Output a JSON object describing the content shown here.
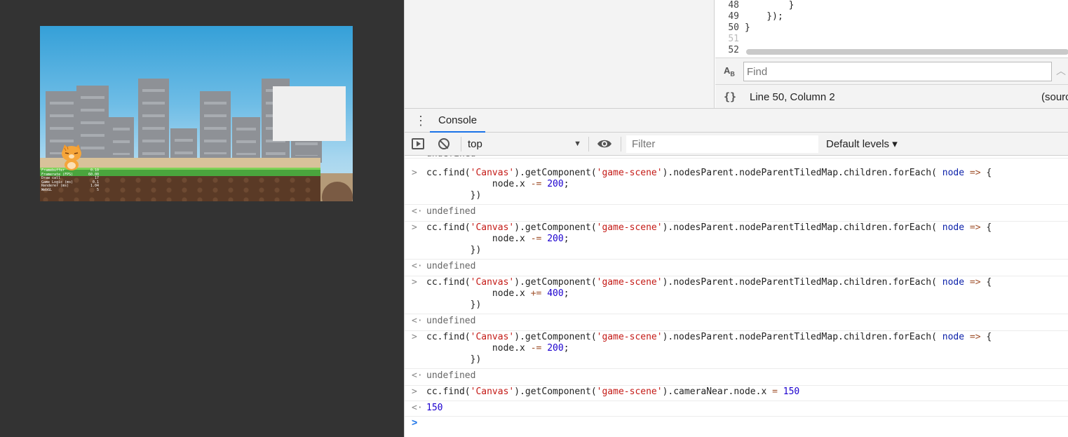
{
  "game_preview": {
    "stats": [
      {
        "label": "Framebuffer",
        "value": "0.10"
      },
      {
        "label": "Framerate (FPS)",
        "value": "60.00"
      },
      {
        "label": "Draw call",
        "value": "17"
      },
      {
        "label": "Game Logic (ms)",
        "value": "0.1"
      },
      {
        "label": "Renderer (ms)",
        "value": "1.04"
      },
      {
        "label": "WebGL",
        "value": "5"
      }
    ]
  },
  "sources": {
    "code_lines": [
      {
        "num": "48",
        "text": "        }"
      },
      {
        "num": "49",
        "text": "    });"
      },
      {
        "num": "50",
        "text": "}"
      },
      {
        "num": "51",
        "text": ""
      },
      {
        "num": "52",
        "text": ""
      }
    ],
    "find_placeholder": "Find",
    "cursor_position": "Line 50, Column 2",
    "source_label": "(sourc"
  },
  "drawer": {
    "tab_console": "Console"
  },
  "console_toolbar": {
    "context": "top",
    "filter_placeholder": "Filter",
    "levels": "Default levels ▾"
  },
  "console": {
    "top_partial": "undefined",
    "entries": [
      {
        "input_line1": {
          "pre": "cc.find(",
          "s1": "'Canvas'",
          "mid": ").getComponent(",
          "s2": "'game-scene'",
          "post": ").nodesParent.nodeParentTiledMap.children.forEach( ",
          "k": "node",
          "arrow": " => ",
          "end": "{"
        },
        "input_line2": {
          "indent": "            node.x ",
          "op": "-=",
          "num": " 200",
          "semi": ";"
        },
        "input_line3": "        })",
        "output": "undefined"
      },
      {
        "input_line1": {
          "pre": "cc.find(",
          "s1": "'Canvas'",
          "mid": ").getComponent(",
          "s2": "'game-scene'",
          "post": ").nodesParent.nodeParentTiledMap.children.forEach( ",
          "k": "node",
          "arrow": " => ",
          "end": "{"
        },
        "input_line2": {
          "indent": "            node.x ",
          "op": "-=",
          "num": " 200",
          "semi": ";"
        },
        "input_line3": "        })",
        "output": "undefined"
      },
      {
        "input_line1": {
          "pre": "cc.find(",
          "s1": "'Canvas'",
          "mid": ").getComponent(",
          "s2": "'game-scene'",
          "post": ").nodesParent.nodeParentTiledMap.children.forEach( ",
          "k": "node",
          "arrow": " => ",
          "end": "{"
        },
        "input_line2": {
          "indent": "            node.x ",
          "op": "+=",
          "num": " 400",
          "semi": ";"
        },
        "input_line3": "        })",
        "output": "undefined"
      },
      {
        "input_line1": {
          "pre": "cc.find(",
          "s1": "'Canvas'",
          "mid": ").getComponent(",
          "s2": "'game-scene'",
          "post": ").nodesParent.nodeParentTiledMap.children.forEach( ",
          "k": "node",
          "arrow": " => ",
          "end": "{"
        },
        "input_line2": {
          "indent": "            node.x ",
          "op": "-=",
          "num": " 200",
          "semi": ";"
        },
        "input_line3": "        })",
        "output": "undefined"
      }
    ],
    "last_input": {
      "pre": "cc.find(",
      "s1": "'Canvas'",
      "mid": ").getComponent(",
      "s2": "'game-scene'",
      "post": ").cameraNear.node.x ",
      "op": "=",
      "num": " 150"
    },
    "last_output": "150"
  }
}
